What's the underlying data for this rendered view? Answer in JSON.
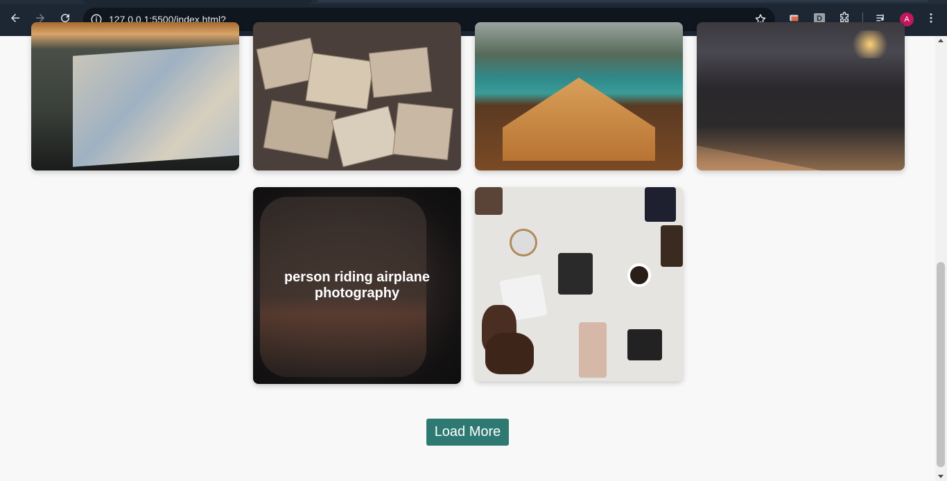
{
  "browser": {
    "url_host": "127.0.0.1",
    "url_path": ":5500/index.html?",
    "profile_initial": "A",
    "extension_badge": "D"
  },
  "gallery": {
    "cards": [
      {
        "name": "map-on-dashboard",
        "caption": ""
      },
      {
        "name": "scattered-maps",
        "caption": ""
      },
      {
        "name": "boat-on-lake",
        "caption": ""
      },
      {
        "name": "desert-dunes",
        "caption": ""
      },
      {
        "name": "airplane-window",
        "caption": "person riding airplane photography"
      },
      {
        "name": "travel-flatlay",
        "caption": ""
      }
    ]
  },
  "load_more_label": "Load More"
}
